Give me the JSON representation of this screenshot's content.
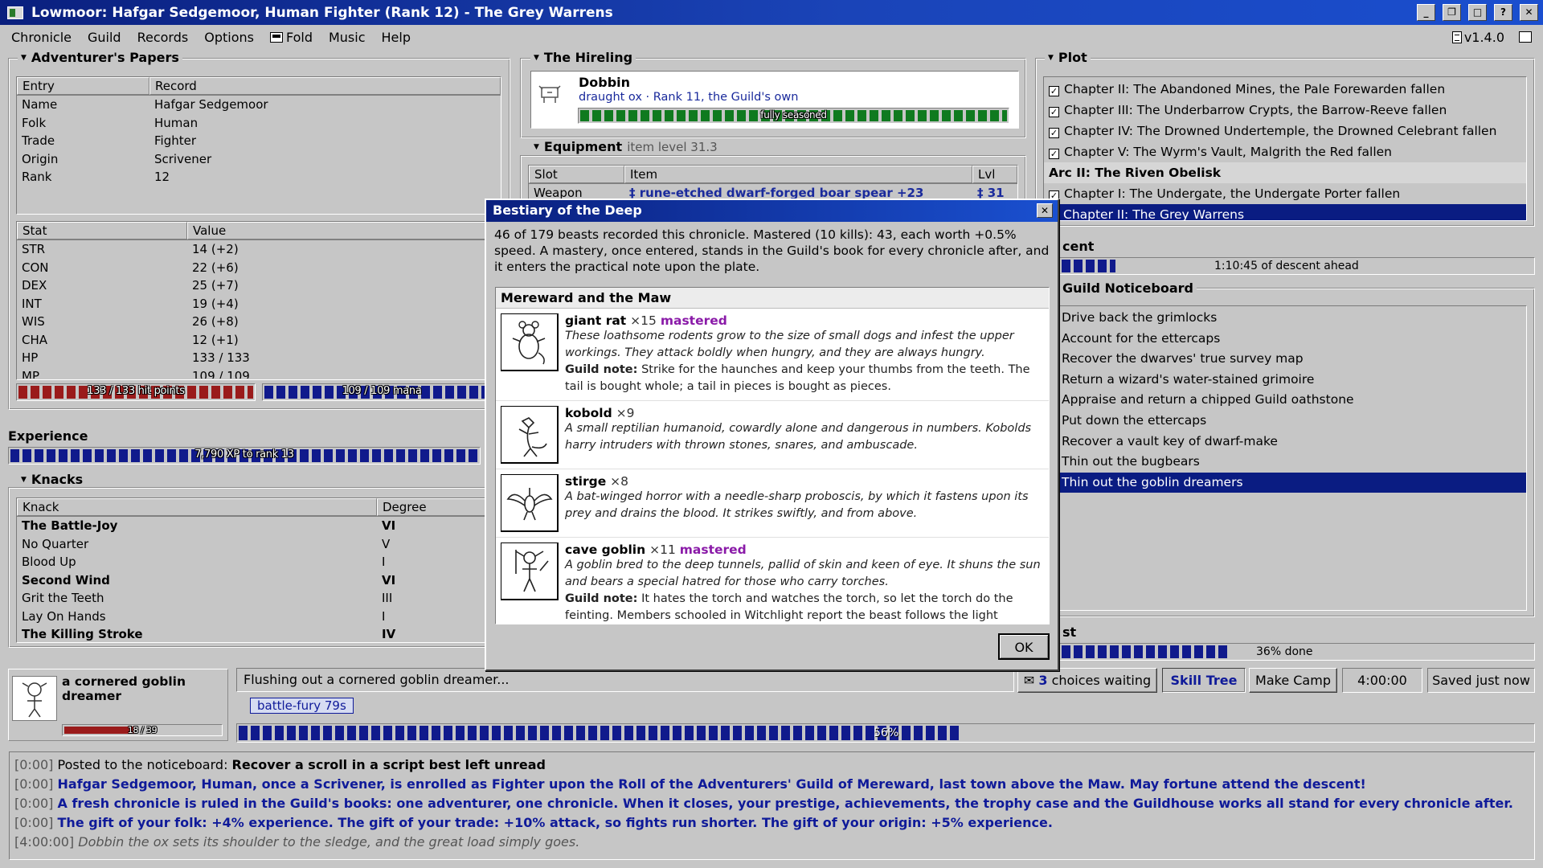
{
  "window": {
    "title": "Lowmoor: Hafgar Sedgemoor, Human Fighter (Rank 12) - The Grey Warrens",
    "buttons": [
      "_",
      "❐",
      "□",
      "?",
      "✕"
    ]
  },
  "menu": {
    "items": [
      "Chronicle",
      "Guild",
      "Records",
      "Options",
      "Fold",
      "Music",
      "Help"
    ],
    "version": "v1.4.0"
  },
  "papers": {
    "title": "Adventurer's Papers",
    "headers": [
      "Entry",
      "Record"
    ],
    "rows": [
      [
        "Name",
        "Hafgar Sedgemoor"
      ],
      [
        "Folk",
        "Human"
      ],
      [
        "Trade",
        "Fighter"
      ],
      [
        "Origin",
        "Scrivener"
      ],
      [
        "Rank",
        "12"
      ]
    ],
    "stat_headers": [
      "Stat",
      "Value"
    ],
    "stats": [
      [
        "STR",
        "14 (+2)"
      ],
      [
        "CON",
        "22 (+6)"
      ],
      [
        "DEX",
        "25 (+7)"
      ],
      [
        "INT",
        "19 (+4)"
      ],
      [
        "WIS",
        "26 (+8)"
      ],
      [
        "CHA",
        "12 (+1)"
      ],
      [
        "HP",
        "133 / 133"
      ],
      [
        "MP",
        "109 / 109"
      ]
    ],
    "hp_label": "133 / 133 hit points",
    "hp_fraction": 1.0,
    "mp_label": "109 / 109 mana",
    "mp_fraction": 1.0
  },
  "experience": {
    "title": "Experience",
    "label": "7,790 XP to rank 13",
    "fraction": 1.0
  },
  "knacks": {
    "title": "Knacks",
    "headers": [
      "Knack",
      "Degree"
    ],
    "rows": [
      {
        "name": "The Battle-Joy",
        "degree": "VI",
        "bold": true
      },
      {
        "name": "No Quarter",
        "degree": "V",
        "bold": false
      },
      {
        "name": "Blood Up",
        "degree": "I",
        "bold": false
      },
      {
        "name": "Second Wind",
        "degree": "VI",
        "bold": true
      },
      {
        "name": "Grit the Teeth",
        "degree": "III",
        "bold": false
      },
      {
        "name": "Lay On Hands",
        "degree": "I",
        "bold": false
      },
      {
        "name": "The Killing Stroke",
        "degree": "IV",
        "bold": true
      }
    ]
  },
  "hireling": {
    "title": "The Hireling",
    "name": "Dobbin",
    "desc": "draught ox · Rank 11, the Guild's own",
    "bar_label": "fully seasoned",
    "fraction": 1.0
  },
  "equipment": {
    "title": "Equipment",
    "subtitle": "item level 31.3",
    "headers": [
      "Slot",
      "Item",
      "Lvl"
    ],
    "rows": [
      [
        "Weapon",
        "‡ rune-etched dwarf-forged boar spear +23",
        "‡ 31"
      ]
    ]
  },
  "plot": {
    "title": "Plot",
    "items": [
      {
        "text": "Chapter II: The Abandoned Mines, the Pale Forewarden fallen",
        "type": "done"
      },
      {
        "text": "Chapter III: The Underbarrow Crypts, the Barrow-Reeve fallen",
        "type": "done"
      },
      {
        "text": "Chapter IV: The Drowned Undertemple, the Drowned Celebrant fallen",
        "type": "done"
      },
      {
        "text": "Chapter V: The Wyrm's Vault, Malgrith the Red fallen",
        "type": "done"
      },
      {
        "text": "Arc II: The Riven Obelisk",
        "type": "arc"
      },
      {
        "text": "Chapter I: The Undergate, the Undergate Porter fallen",
        "type": "done"
      },
      {
        "text": "Chapter II: The Grey Warrens",
        "type": "current"
      }
    ]
  },
  "descent": {
    "title": "cent",
    "label": "1:10:45 of descent ahead",
    "fraction": 0.12
  },
  "noticeboard": {
    "title": "Guild Noticeboard",
    "items": [
      "Drive back the grimlocks",
      "Account for the ettercaps",
      "Recover the dwarves' true survey map",
      "Return a wizard's water-stained grimoire",
      "Appraise and return a chipped Guild oathstone",
      "Put down the ettercaps",
      "Recover a vault key of dwarf-make",
      "Thin out the bugbears",
      "Thin out the goblin dreamers"
    ],
    "selected": 8
  },
  "quest": {
    "title": "st",
    "label": "36% done",
    "fraction": 0.36
  },
  "encounter": {
    "name": "a cornered goblin dreamer",
    "hp_label": "18 / 39",
    "hp_fraction": 0.46
  },
  "action": {
    "text": "Flushing out a cornered goblin dreamer...",
    "buff": "battle-fury 79s",
    "label": "56%",
    "fraction": 0.56
  },
  "buttons": {
    "choices_count": "3",
    "choices_label": "choices waiting",
    "skill_tree": "Skill Tree",
    "make_camp": "Make Camp",
    "timer": "4:00:00",
    "saved": "Saved just now"
  },
  "dialog": {
    "title": "Bestiary of the Deep",
    "close": "✕",
    "intro": "46 of 179 beasts recorded this chronicle. Mastered (10 kills): 43, each worth +0.5% speed. A mastery, once entered, stands in the Guild's book for every chronicle after, and it enters the practical note upon the plate.",
    "section": "Mereward and the Maw",
    "beasts": [
      {
        "name": "giant rat",
        "count": "×15",
        "mastered": "mastered",
        "desc": "These loathsome rodents grow to the size of small dogs and infest the upper workings. They attack boldly when hungry, and they are always hungry.",
        "note_label": "Guild note:",
        "note": "Strike for the haunches and keep your thumbs from the teeth. The tail is bought whole; a tail in pieces is bought as pieces."
      },
      {
        "name": "kobold",
        "count": "×9",
        "mastered": "",
        "desc": "A small reptilian humanoid, cowardly alone and dangerous in numbers. Kobolds harry intruders with thrown stones, snares, and ambuscade.",
        "note_label": "",
        "note": ""
      },
      {
        "name": "stirge",
        "count": "×8",
        "mastered": "",
        "desc": "A bat-winged horror with a needle-sharp proboscis, by which it fastens upon its prey and drains the blood. It strikes swiftly, and from above.",
        "note_label": "",
        "note": ""
      },
      {
        "name": "cave goblin",
        "count": "×11",
        "mastered": "mastered",
        "desc": "A goblin bred to the deep tunnels, pallid of skin and keen of eye. It shuns the sun and bears a special hatred for those who carry torches.",
        "note_label": "Guild note:",
        "note": "It hates the torch and watches the torch, so let the torch do the feinting. Members schooled in Witchlight report the beast follows the light wherever the light is."
      }
    ],
    "ok": "OK"
  },
  "log": [
    {
      "ts": "[0:00]",
      "prefix": "Posted to the noticeboard:",
      "text": "Recover a scroll in a script best left unread",
      "style": "notice"
    },
    {
      "ts": "[0:00]",
      "prefix": "",
      "text": "Hafgar Sedgemoor, Human, once a Scrivener, is enrolled as Fighter upon the Roll of the Adventurers' Guild of Mereward, last town above the Maw. May fortune attend the descent!",
      "style": "blue"
    },
    {
      "ts": "[0:00]",
      "prefix": "",
      "text": "A fresh chronicle is ruled in the Guild's books: one adventurer, one chronicle. When it closes, your prestige, achievements, the trophy case and the Guildhouse works all stand for every chronicle after.",
      "style": "blue"
    },
    {
      "ts": "[0:00]",
      "prefix": "",
      "text": "The gift of your folk: +4% experience. The gift of your trade: +10% attack, so fights run shorter. The gift of your origin: +5% experience.",
      "style": "blue"
    },
    {
      "ts": "[4:00:00]",
      "prefix": "",
      "text": "Dobbin the ox sets its shoulder to the sledge, and the great load simply goes.",
      "style": "grey"
    }
  ]
}
